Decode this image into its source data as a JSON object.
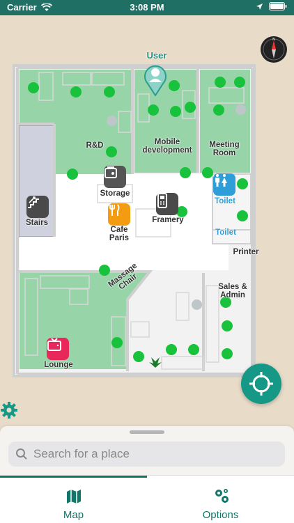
{
  "status_bar": {
    "carrier": "Carrier",
    "time": "3:08 PM"
  },
  "map": {
    "user_label": "User",
    "rooms": {
      "rd": "R&D",
      "mobile": "Mobile\ndevelopment",
      "meeting": "Meeting\nRoom",
      "storage": "Storage",
      "stairs": "Stairs",
      "cafe": "Cafe\nParis",
      "framery": "Framery",
      "toilet1": "Toilet",
      "toilet2": "Toilet",
      "printer": "Printer",
      "massage": "Massage\nChair",
      "sales": "Sales &\nAdmin",
      "lounge": "Lounge"
    }
  },
  "search": {
    "placeholder": "Search for a place"
  },
  "tabs": [
    {
      "label": "Map",
      "icon": "map-icon"
    },
    {
      "label": "Options",
      "icon": "gears-icon"
    }
  ],
  "colors": {
    "accent": "#12766a",
    "green_room": "#97d4a8",
    "beacon": "#19c23d"
  }
}
